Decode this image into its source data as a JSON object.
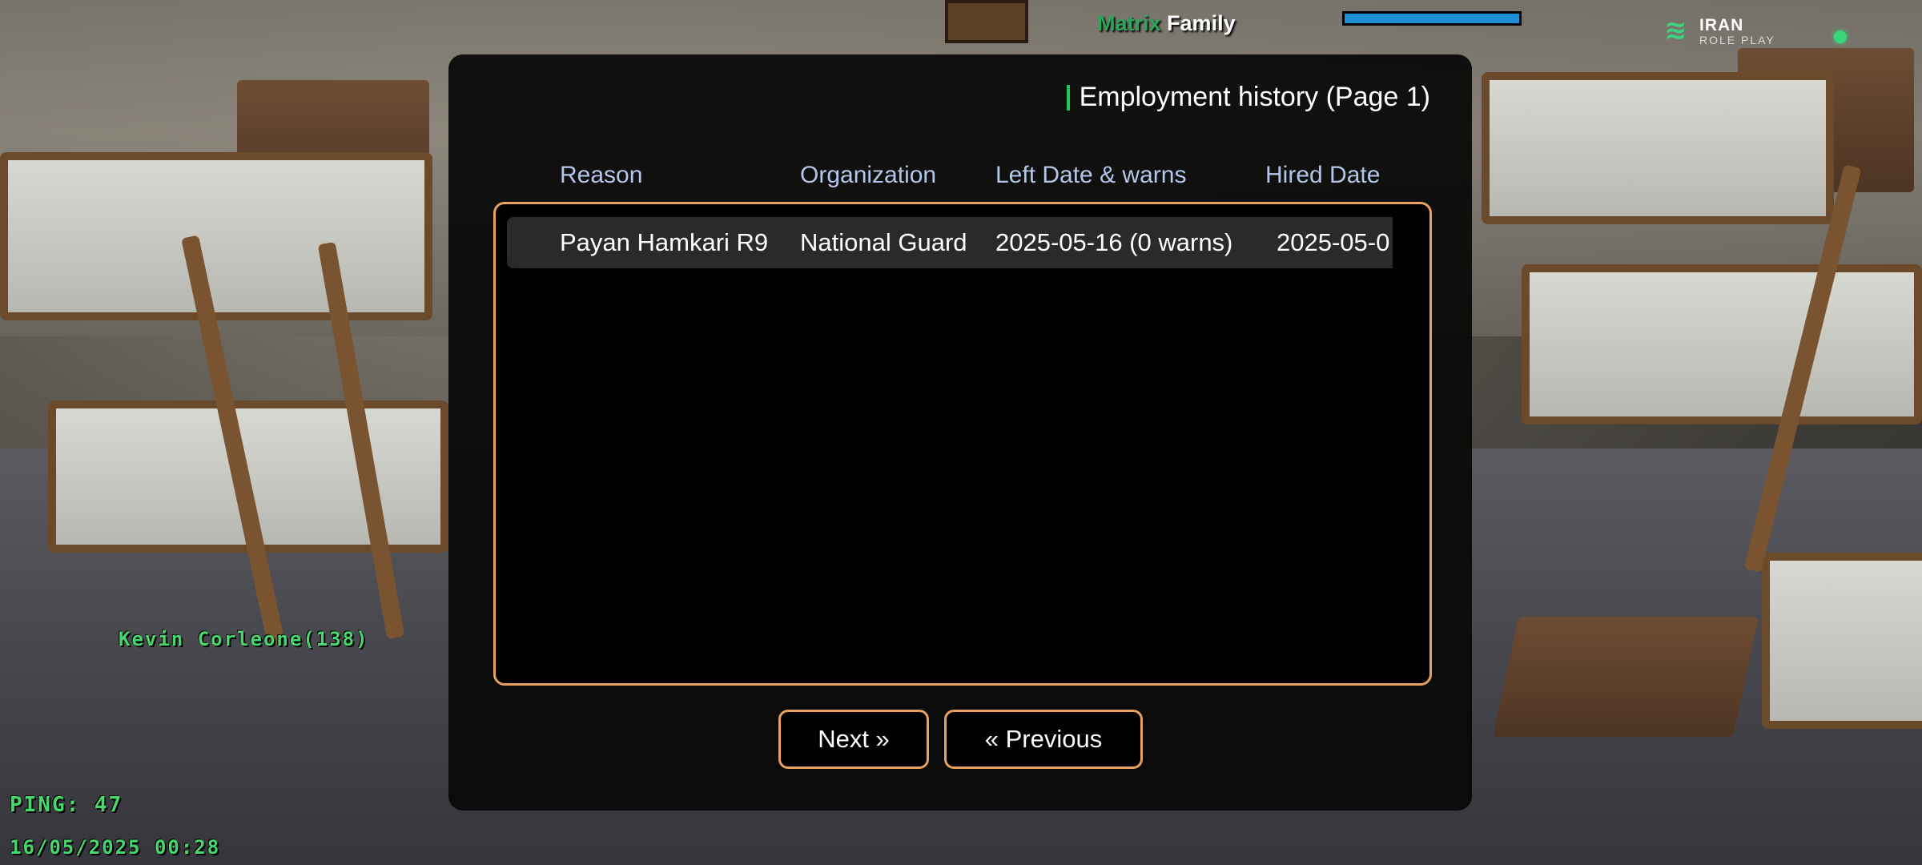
{
  "hud": {
    "family_accent": "Matrix",
    "family_name": "Family",
    "logo_line1": "IRAN",
    "logo_line2": "ROLE PLAY",
    "player_tag": "Kevin Corleone(138)",
    "ping": "PING: 47",
    "datetime": "16/05/2025 00:28"
  },
  "dialog": {
    "title": "Employment history (Page 1)",
    "columns": [
      "Reason",
      "Organization",
      "Left Date & warns",
      "Hired Date"
    ],
    "rows": [
      {
        "reason": "Payan Hamkari R9",
        "organization": "National Guard",
        "left_date": "2025-05-16 (0 warns)",
        "hired_date": "2025-05-0"
      }
    ],
    "next_label": "Next »",
    "previous_label": "« Previous"
  },
  "colors": {
    "accent_border": "#e8a15e",
    "header_text": "#b4c6ea",
    "title_accent": "#22c55e",
    "hud_green": "#48d76a",
    "hud_bar": "#1e8fd6"
  }
}
